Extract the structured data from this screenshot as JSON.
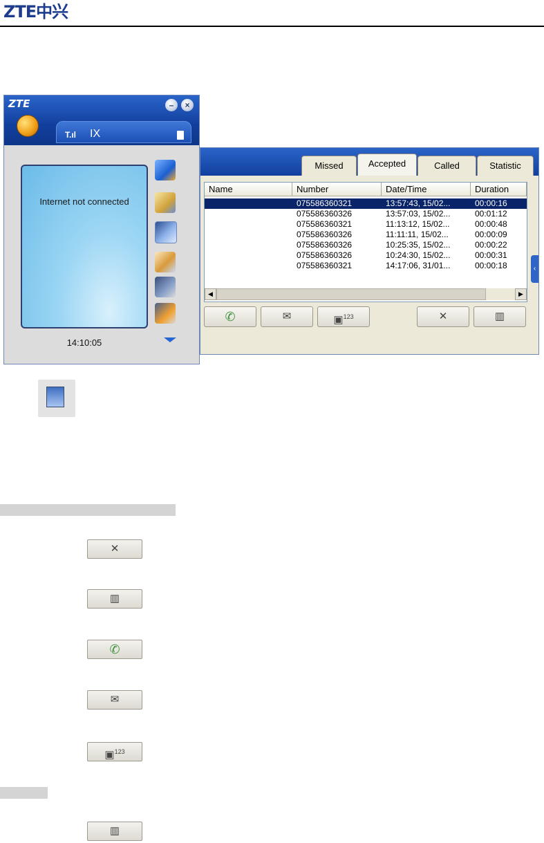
{
  "header": {
    "logo_text": "ZTE中兴"
  },
  "main_window": {
    "title": "ZTE",
    "network": "IX",
    "signal_glyph": "T.ıl",
    "screen_status": "Internet not connected",
    "clock": "14:10:05",
    "minimize_glyph": "–",
    "close_glyph": "×",
    "side_icons": [
      "internet-icon",
      "contacts-icon",
      "call-log-icon",
      "sms-icon",
      "sim-phonebook-icon",
      "settings-icon"
    ]
  },
  "call_log": {
    "tabs": [
      "Missed",
      "Accepted",
      "Called",
      "Statistic"
    ],
    "active_tab": "Accepted",
    "columns": [
      "Name",
      "Number",
      "Date/Time",
      "Duration"
    ],
    "rows": [
      {
        "name": "",
        "number": "075586360321",
        "datetime": "13:57:43, 15/02...",
        "duration": "00:00:16",
        "selected": true
      },
      {
        "name": "",
        "number": "075586360326",
        "datetime": "13:57:03, 15/02...",
        "duration": "00:01:12"
      },
      {
        "name": "",
        "number": "075586360321",
        "datetime": "11:13:12, 15/02...",
        "duration": "00:00:48"
      },
      {
        "name": "",
        "number": "075586360326",
        "datetime": "11:11:11, 15/02...",
        "duration": "00:00:09"
      },
      {
        "name": "",
        "number": "075586360326",
        "datetime": "10:25:35, 15/02...",
        "duration": "00:00:22"
      },
      {
        "name": "",
        "number": "075586360326",
        "datetime": "10:24:30, 15/02...",
        "duration": "00:00:31"
      },
      {
        "name": "",
        "number": "075586360321",
        "datetime": "14:17:06, 31/01...",
        "duration": "00:00:18"
      }
    ],
    "toolbar": {
      "dial_glyph": "✆",
      "sms_glyph": "✉",
      "save_glyph": "▣",
      "save_sup": "123",
      "tools_glyph": "✕",
      "delete_glyph": "▥"
    },
    "scroll_left": "◀",
    "scroll_right": "▶",
    "collapse_glyph": "‹"
  },
  "demo_buttons": {
    "tools_glyph": "✕",
    "delete_glyph": "▥",
    "dial_glyph": "✆",
    "sms_glyph": "✉",
    "save_glyph": "▣",
    "save_sup": "123"
  },
  "colors": {
    "brand_blue": "#1d3c8f",
    "title_blue": "#1c4fb4",
    "selection": "#0a246a"
  }
}
